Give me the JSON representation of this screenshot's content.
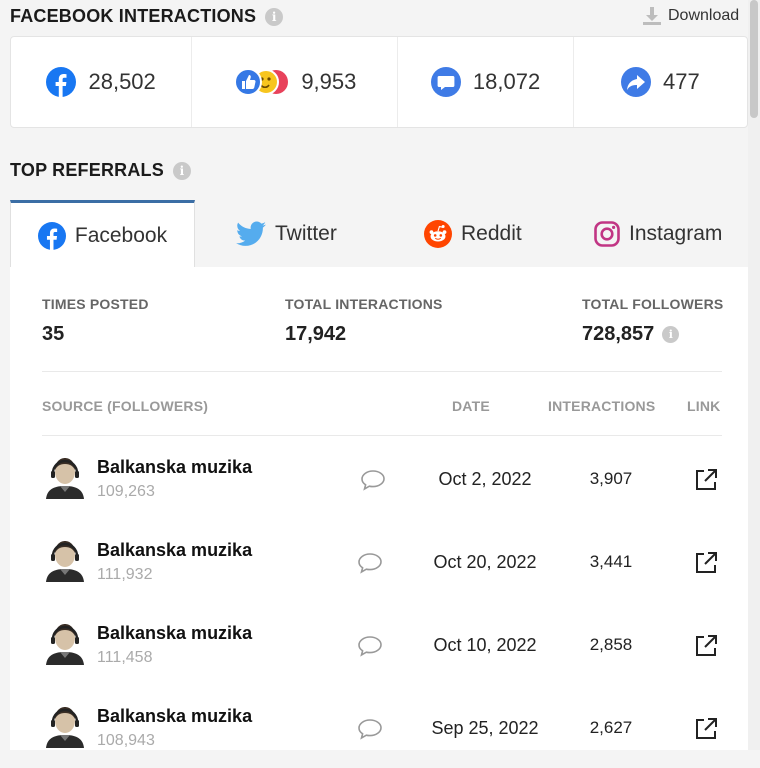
{
  "facebook_interactions": {
    "title": "FACEBOOK INTERACTIONS",
    "download_label": "Download",
    "stats": [
      {
        "icon": "facebook-icon",
        "value": "28,502"
      },
      {
        "icon": "reactions-icon",
        "value": "9,953"
      },
      {
        "icon": "comment-bubble-icon",
        "value": "18,072"
      },
      {
        "icon": "share-arrow-icon",
        "value": "477"
      }
    ]
  },
  "top_referrals": {
    "title": "TOP REFERRALS",
    "tabs": [
      {
        "label": "Facebook",
        "icon": "facebook-icon",
        "active": true
      },
      {
        "label": "Twitter",
        "icon": "twitter-icon",
        "active": false
      },
      {
        "label": "Reddit",
        "icon": "reddit-icon",
        "active": false
      },
      {
        "label": "Instagram",
        "icon": "instagram-icon",
        "active": false
      }
    ],
    "metrics": {
      "times_posted_label": "TIMES POSTED",
      "times_posted": "35",
      "total_interactions_label": "TOTAL INTERACTIONS",
      "total_interactions": "17,942",
      "total_followers_label": "TOTAL FOLLOWERS",
      "total_followers": "728,857"
    },
    "table": {
      "headers": {
        "source": "SOURCE (FOLLOWERS)",
        "date": "DATE",
        "interactions": "INTERACTIONS",
        "link": "LINK"
      },
      "rows": [
        {
          "name": "Balkanska muzika",
          "followers": "109,263",
          "date": "Oct 2, 2022",
          "interactions": "3,907"
        },
        {
          "name": "Balkanska muzika",
          "followers": "111,932",
          "date": "Oct 20, 2022",
          "interactions": "3,441"
        },
        {
          "name": "Balkanska muzika",
          "followers": "111,458",
          "date": "Oct 10, 2022",
          "interactions": "2,858"
        },
        {
          "name": "Balkanska muzika",
          "followers": "108,943",
          "date": "Sep 25, 2022",
          "interactions": "2,627"
        }
      ]
    }
  },
  "colors": {
    "facebook_blue": "#1877f2",
    "twitter_blue": "#1da1f2",
    "reddit_orange": "#ff4500",
    "instagram_pink": "#c13584",
    "active_tab_border": "#3b6ea5"
  }
}
